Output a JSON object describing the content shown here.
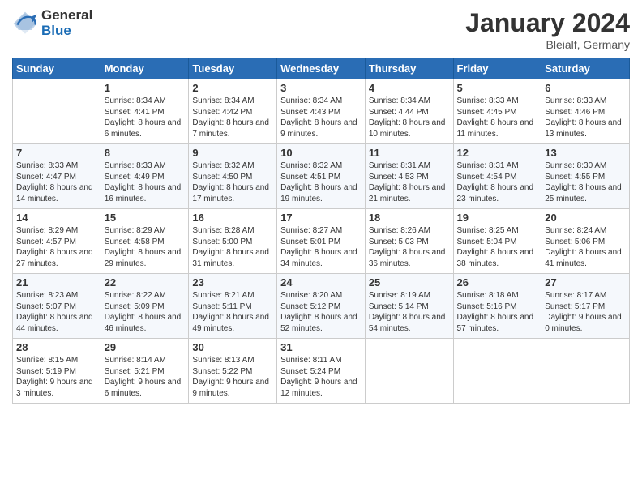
{
  "header": {
    "logo_general": "General",
    "logo_blue": "Blue",
    "month_title": "January 2024",
    "location": "Bleialf, Germany"
  },
  "weekdays": [
    "Sunday",
    "Monday",
    "Tuesday",
    "Wednesday",
    "Thursday",
    "Friday",
    "Saturday"
  ],
  "weeks": [
    [
      {
        "day": "",
        "sunrise": "",
        "sunset": "",
        "daylight": ""
      },
      {
        "day": "1",
        "sunrise": "Sunrise: 8:34 AM",
        "sunset": "Sunset: 4:41 PM",
        "daylight": "Daylight: 8 hours and 6 minutes."
      },
      {
        "day": "2",
        "sunrise": "Sunrise: 8:34 AM",
        "sunset": "Sunset: 4:42 PM",
        "daylight": "Daylight: 8 hours and 7 minutes."
      },
      {
        "day": "3",
        "sunrise": "Sunrise: 8:34 AM",
        "sunset": "Sunset: 4:43 PM",
        "daylight": "Daylight: 8 hours and 9 minutes."
      },
      {
        "day": "4",
        "sunrise": "Sunrise: 8:34 AM",
        "sunset": "Sunset: 4:44 PM",
        "daylight": "Daylight: 8 hours and 10 minutes."
      },
      {
        "day": "5",
        "sunrise": "Sunrise: 8:33 AM",
        "sunset": "Sunset: 4:45 PM",
        "daylight": "Daylight: 8 hours and 11 minutes."
      },
      {
        "day": "6",
        "sunrise": "Sunrise: 8:33 AM",
        "sunset": "Sunset: 4:46 PM",
        "daylight": "Daylight: 8 hours and 13 minutes."
      }
    ],
    [
      {
        "day": "7",
        "sunrise": "Sunrise: 8:33 AM",
        "sunset": "Sunset: 4:47 PM",
        "daylight": "Daylight: 8 hours and 14 minutes."
      },
      {
        "day": "8",
        "sunrise": "Sunrise: 8:33 AM",
        "sunset": "Sunset: 4:49 PM",
        "daylight": "Daylight: 8 hours and 16 minutes."
      },
      {
        "day": "9",
        "sunrise": "Sunrise: 8:32 AM",
        "sunset": "Sunset: 4:50 PM",
        "daylight": "Daylight: 8 hours and 17 minutes."
      },
      {
        "day": "10",
        "sunrise": "Sunrise: 8:32 AM",
        "sunset": "Sunset: 4:51 PM",
        "daylight": "Daylight: 8 hours and 19 minutes."
      },
      {
        "day": "11",
        "sunrise": "Sunrise: 8:31 AM",
        "sunset": "Sunset: 4:53 PM",
        "daylight": "Daylight: 8 hours and 21 minutes."
      },
      {
        "day": "12",
        "sunrise": "Sunrise: 8:31 AM",
        "sunset": "Sunset: 4:54 PM",
        "daylight": "Daylight: 8 hours and 23 minutes."
      },
      {
        "day": "13",
        "sunrise": "Sunrise: 8:30 AM",
        "sunset": "Sunset: 4:55 PM",
        "daylight": "Daylight: 8 hours and 25 minutes."
      }
    ],
    [
      {
        "day": "14",
        "sunrise": "Sunrise: 8:29 AM",
        "sunset": "Sunset: 4:57 PM",
        "daylight": "Daylight: 8 hours and 27 minutes."
      },
      {
        "day": "15",
        "sunrise": "Sunrise: 8:29 AM",
        "sunset": "Sunset: 4:58 PM",
        "daylight": "Daylight: 8 hours and 29 minutes."
      },
      {
        "day": "16",
        "sunrise": "Sunrise: 8:28 AM",
        "sunset": "Sunset: 5:00 PM",
        "daylight": "Daylight: 8 hours and 31 minutes."
      },
      {
        "day": "17",
        "sunrise": "Sunrise: 8:27 AM",
        "sunset": "Sunset: 5:01 PM",
        "daylight": "Daylight: 8 hours and 34 minutes."
      },
      {
        "day": "18",
        "sunrise": "Sunrise: 8:26 AM",
        "sunset": "Sunset: 5:03 PM",
        "daylight": "Daylight: 8 hours and 36 minutes."
      },
      {
        "day": "19",
        "sunrise": "Sunrise: 8:25 AM",
        "sunset": "Sunset: 5:04 PM",
        "daylight": "Daylight: 8 hours and 38 minutes."
      },
      {
        "day": "20",
        "sunrise": "Sunrise: 8:24 AM",
        "sunset": "Sunset: 5:06 PM",
        "daylight": "Daylight: 8 hours and 41 minutes."
      }
    ],
    [
      {
        "day": "21",
        "sunrise": "Sunrise: 8:23 AM",
        "sunset": "Sunset: 5:07 PM",
        "daylight": "Daylight: 8 hours and 44 minutes."
      },
      {
        "day": "22",
        "sunrise": "Sunrise: 8:22 AM",
        "sunset": "Sunset: 5:09 PM",
        "daylight": "Daylight: 8 hours and 46 minutes."
      },
      {
        "day": "23",
        "sunrise": "Sunrise: 8:21 AM",
        "sunset": "Sunset: 5:11 PM",
        "daylight": "Daylight: 8 hours and 49 minutes."
      },
      {
        "day": "24",
        "sunrise": "Sunrise: 8:20 AM",
        "sunset": "Sunset: 5:12 PM",
        "daylight": "Daylight: 8 hours and 52 minutes."
      },
      {
        "day": "25",
        "sunrise": "Sunrise: 8:19 AM",
        "sunset": "Sunset: 5:14 PM",
        "daylight": "Daylight: 8 hours and 54 minutes."
      },
      {
        "day": "26",
        "sunrise": "Sunrise: 8:18 AM",
        "sunset": "Sunset: 5:16 PM",
        "daylight": "Daylight: 8 hours and 57 minutes."
      },
      {
        "day": "27",
        "sunrise": "Sunrise: 8:17 AM",
        "sunset": "Sunset: 5:17 PM",
        "daylight": "Daylight: 9 hours and 0 minutes."
      }
    ],
    [
      {
        "day": "28",
        "sunrise": "Sunrise: 8:15 AM",
        "sunset": "Sunset: 5:19 PM",
        "daylight": "Daylight: 9 hours and 3 minutes."
      },
      {
        "day": "29",
        "sunrise": "Sunrise: 8:14 AM",
        "sunset": "Sunset: 5:21 PM",
        "daylight": "Daylight: 9 hours and 6 minutes."
      },
      {
        "day": "30",
        "sunrise": "Sunrise: 8:13 AM",
        "sunset": "Sunset: 5:22 PM",
        "daylight": "Daylight: 9 hours and 9 minutes."
      },
      {
        "day": "31",
        "sunrise": "Sunrise: 8:11 AM",
        "sunset": "Sunset: 5:24 PM",
        "daylight": "Daylight: 9 hours and 12 minutes."
      },
      {
        "day": "",
        "sunrise": "",
        "sunset": "",
        "daylight": ""
      },
      {
        "day": "",
        "sunrise": "",
        "sunset": "",
        "daylight": ""
      },
      {
        "day": "",
        "sunrise": "",
        "sunset": "",
        "daylight": ""
      }
    ]
  ]
}
